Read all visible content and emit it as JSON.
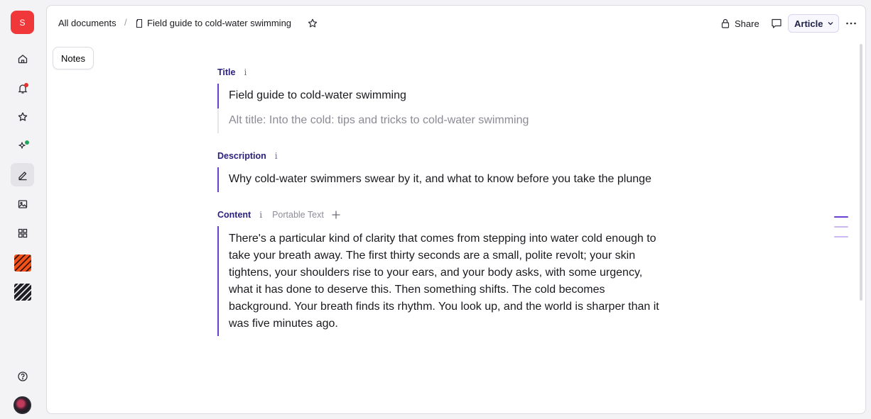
{
  "app": {
    "logo_letter": "S"
  },
  "rail": {
    "items": [
      {
        "name": "home-icon"
      },
      {
        "name": "bell-icon",
        "badge_color": "#e5322d"
      },
      {
        "name": "star-icon"
      },
      {
        "name": "sparkle-icon",
        "badge_color": "#22a55b"
      },
      {
        "name": "edit-icon",
        "active": true
      },
      {
        "name": "image-icon"
      },
      {
        "name": "grid-icon"
      },
      {
        "name": "orange-workspace-icon"
      },
      {
        "name": "dark-workspace-icon"
      }
    ],
    "help_icon": "help-icon"
  },
  "breadcrumb": {
    "root": "All documents",
    "separator": "/",
    "document": "Field guide to cold-water swimming"
  },
  "toolbar": {
    "share_label": "Share",
    "type_label": "Article"
  },
  "notes_label": "Notes",
  "form": {
    "title": {
      "label": "Title",
      "info": "i",
      "value": "Field guide to cold-water swimming",
      "alt_placeholder": "Alt title: Into the cold: tips and tricks to cold-water swimming"
    },
    "description": {
      "label": "Description",
      "info": "i",
      "value": "Why cold-water swimmers swear by it, and what to know before you take the plunge"
    },
    "content": {
      "label": "Content",
      "info": "i",
      "type_label": "Portable Text",
      "lines": [
        "There's a particular kind of clarity that comes from stepping into water cold enough to",
        "take your breath away. The first thirty seconds are a small, polite revolt; your skin",
        "tightens, your shoulders rise to your ears, and your body asks, with some urgency,",
        "what it has done to deserve this. Then something shifts. The cold becomes",
        "background. Your breath finds its rhythm. You look up, and the world is sharper than it",
        "was five minutes ago."
      ]
    }
  },
  "colors": {
    "accent": "#6b3fd4",
    "label": "#2a1f7a",
    "logo": "#f0383a"
  }
}
